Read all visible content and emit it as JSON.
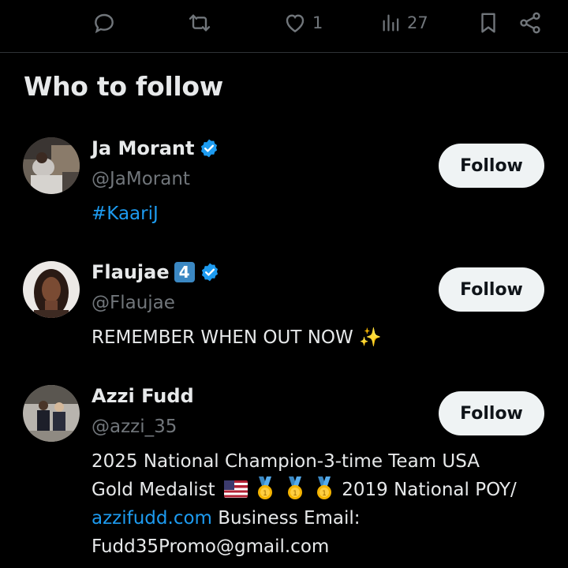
{
  "actions": {
    "likes": "1",
    "views": "27"
  },
  "who_to_follow": {
    "title": "Who to follow",
    "users": [
      {
        "name": "Ja Morant",
        "handle": "@JaMorant",
        "bio": "#KaariJ",
        "follow_label": "Follow",
        "verified": true
      },
      {
        "name": "Flaujae",
        "badge": "4",
        "handle": "@Flaujae",
        "bio": "REMEMBER WHEN OUT NOW",
        "bio_emoji": "sparkles-icon",
        "follow_label": "Follow",
        "verified": true
      },
      {
        "name": "Azzi Fudd",
        "handle": "@azzi_35",
        "bio_line1": "2025 National Champion-3-time Team USA",
        "bio_line2_prefix": "Gold Medalist",
        "bio_line2_suffix": "2019 National POY/",
        "bio_link": "azzifudd.com",
        "bio_line3_suffix": " Business Email:",
        "bio_line4": "Fudd35Promo@gmail.com",
        "follow_label": "Follow",
        "verified": false
      }
    ]
  },
  "colors": {
    "background": "#000000",
    "text": "#e7e9ea",
    "muted": "#71767b",
    "link": "#1d9bf0",
    "verified": "#1d9bf0",
    "button_bg": "#eff3f4",
    "button_text": "#0f1419"
  }
}
